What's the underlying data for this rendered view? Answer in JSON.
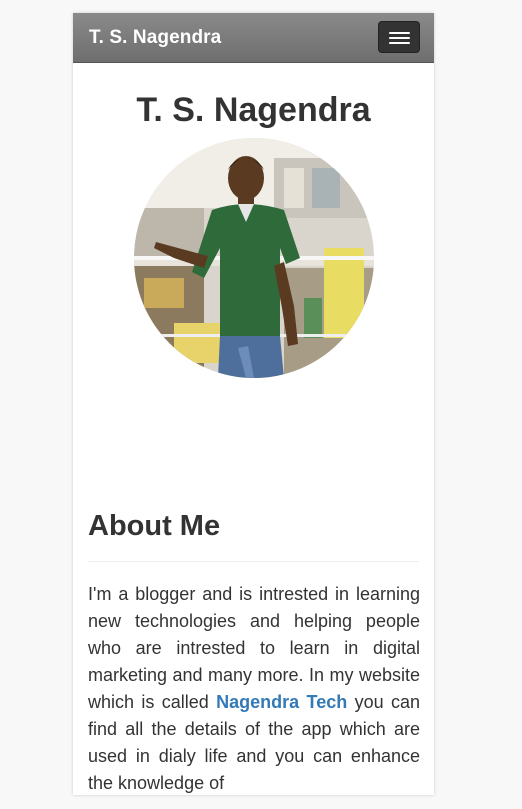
{
  "navbar": {
    "brand": "T. S. Nagendra",
    "menu_icon": "hamburger-menu-icon"
  },
  "profile": {
    "name": "T. S. Nagendra",
    "photo": "profile-photo"
  },
  "about": {
    "heading": "About Me",
    "text_before_link": "I'm a blogger and is intrested in learning new technologies and helping people who are intrested to learn in digital marketing and many more. In my website which is called ",
    "link_text": "Nagendra Tech",
    "text_after_link": " you can find all the details of the app which are used in dialy life and you can enhance the knowledge of"
  },
  "colors": {
    "navbar": "#7c7c7c",
    "link": "#337ab7",
    "text": "#333333"
  }
}
